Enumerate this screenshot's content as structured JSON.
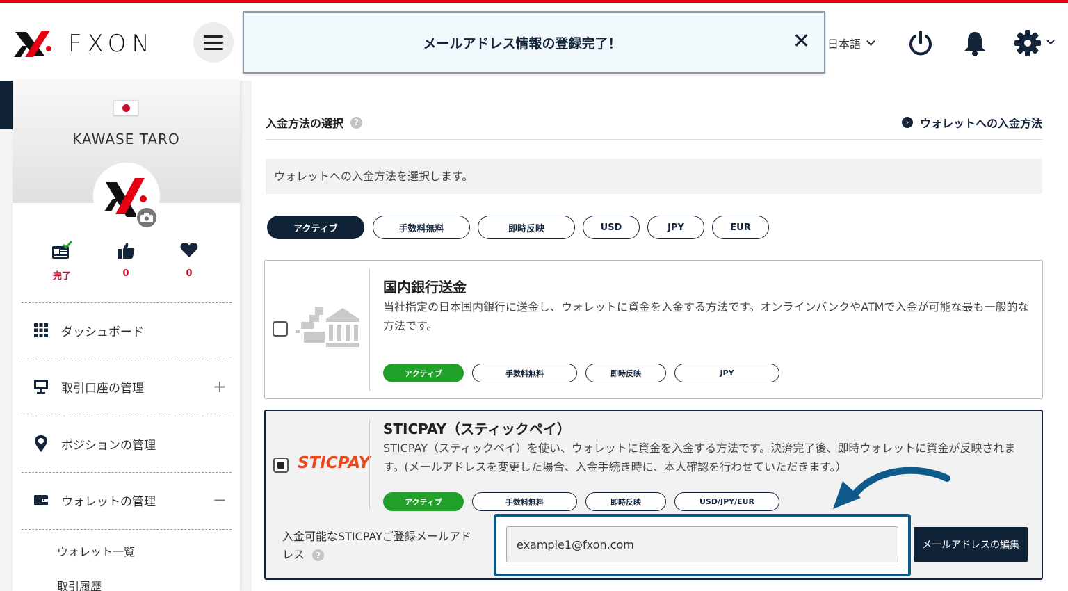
{
  "header": {
    "brand": "FXON",
    "notification": "メールアドレス情報の登録完了！",
    "close_glyph": "✕",
    "language": "日本語",
    "icons": [
      "menu-icon",
      "power-icon",
      "bell-icon",
      "gear-icon"
    ],
    "accent_color": "#e60012"
  },
  "sidebar": {
    "username": "KAWASE TARO",
    "stats": [
      {
        "icon": "id-card-check-icon",
        "value": "完了"
      },
      {
        "icon": "thumbs-up-icon",
        "value": "0"
      },
      {
        "icon": "heart-icon",
        "value": "0"
      }
    ],
    "nav": [
      {
        "icon": "grid-icon",
        "label": "ダッシュボード",
        "toggle": ""
      },
      {
        "icon": "monitor-icon",
        "label": "取引口座の管理",
        "toggle": "+"
      },
      {
        "icon": "map-pin-icon",
        "label": "ポジションの管理",
        "toggle": ""
      },
      {
        "icon": "wallet-icon",
        "label": "ウォレットの管理",
        "toggle": "−"
      }
    ],
    "sub_items": [
      "ウォレット一覧",
      "取引履歴"
    ]
  },
  "main": {
    "section_title": "入金方法の選択",
    "section_link": "ウォレットへの入金方法",
    "info": "ウォレットへの入金方法を選択します。",
    "filters": [
      "アクティブ",
      "手数料無料",
      "即時反映",
      "USD",
      "JPY",
      "EUR"
    ],
    "active_filter": "アクティブ",
    "methods": [
      {
        "title": "国内銀行送金",
        "description": "当社指定の日本国内銀行に送金し、ウォレットに資金を入金する方法です。オンラインバンクやATMで入金が可能な最も一般的な方法です。",
        "tags": [
          "アクティブ",
          "手数料無料",
          "即時反映",
          "JPY"
        ],
        "selected": false
      },
      {
        "title": "STICPAY（スティックペイ）",
        "logo_text": "STICPAY",
        "description": "STICPAY（スティックペイ）を使い、ウォレットに資金を入金する方法です。決済完了後、即時ウォレットに資金が反映されます。(メールアドレスを変更した場合、入金手続き時に、本人確認を行わせていただきます。）",
        "tags": [
          "アクティブ",
          "手数料無料",
          "即時反映",
          "USD/JPY/EUR"
        ],
        "selected": true
      }
    ],
    "email_label": "入金可能なSTICPAYご登録メールアドレス",
    "email_value": "example1@fxon.com",
    "edit_button": "メールアドレスの編集"
  }
}
